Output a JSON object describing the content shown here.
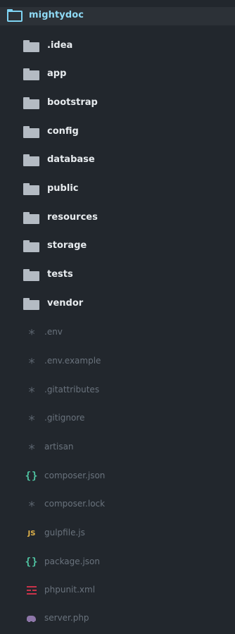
{
  "root": {
    "label": "mightydoc",
    "icon": "folder-outline-icon"
  },
  "folders": [
    {
      "label": ".idea",
      "icon": "folder-icon"
    },
    {
      "label": "app",
      "icon": "folder-icon"
    },
    {
      "label": "bootstrap",
      "icon": "folder-icon"
    },
    {
      "label": "config",
      "icon": "folder-icon"
    },
    {
      "label": "database",
      "icon": "folder-icon"
    },
    {
      "label": "public",
      "icon": "folder-icon"
    },
    {
      "label": "resources",
      "icon": "folder-icon"
    },
    {
      "label": "storage",
      "icon": "folder-icon"
    },
    {
      "label": "tests",
      "icon": "folder-icon"
    },
    {
      "label": "vendor",
      "icon": "folder-icon"
    }
  ],
  "files": [
    {
      "label": ".env",
      "icon": "asterisk-icon"
    },
    {
      "label": ".env.example",
      "icon": "asterisk-icon"
    },
    {
      "label": ".gitattributes",
      "icon": "asterisk-icon"
    },
    {
      "label": ".gitignore",
      "icon": "asterisk-icon"
    },
    {
      "label": "artisan",
      "icon": "asterisk-icon"
    },
    {
      "label": "composer.json",
      "icon": "json-braces-icon",
      "glyph": "{}"
    },
    {
      "label": "composer.lock",
      "icon": "asterisk-icon"
    },
    {
      "label": "gulpfile.js",
      "icon": "javascript-icon",
      "glyph": "JS"
    },
    {
      "label": "package.json",
      "icon": "json-braces-icon",
      "glyph": "{}"
    },
    {
      "label": "phpunit.xml",
      "icon": "xml-icon"
    },
    {
      "label": "server.php",
      "icon": "php-elephant-icon"
    }
  ],
  "colors": {
    "background": "#22272d",
    "root_highlight": "#2c3137",
    "root_accent": "#7ed3f2",
    "folder_icon": "#b4bbc3",
    "folder_text": "#e7ebee",
    "file_text": "#6a737d",
    "json_icon": "#4fc3a1",
    "js_icon": "#e0b24a",
    "xml_icon": "#c9334a",
    "php_icon": "#8d76a8"
  }
}
